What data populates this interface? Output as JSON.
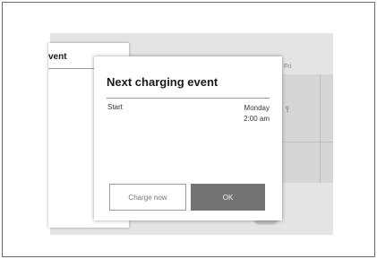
{
  "background": {
    "day_label": "Fri",
    "pin_icon": "location-pin-icon"
  },
  "back_dialog": {
    "title": "vent"
  },
  "dialog": {
    "title": "Next charging event",
    "row": {
      "label": "Start",
      "value_day": "Monday",
      "value_time": "2:00 am"
    },
    "buttons": {
      "charge_now": "Charge now",
      "ok": "OK"
    }
  },
  "colors": {
    "screen_bg": "#e4e4e4",
    "ok_button_bg": "#737373",
    "frame_border": "#6e6e6e"
  }
}
